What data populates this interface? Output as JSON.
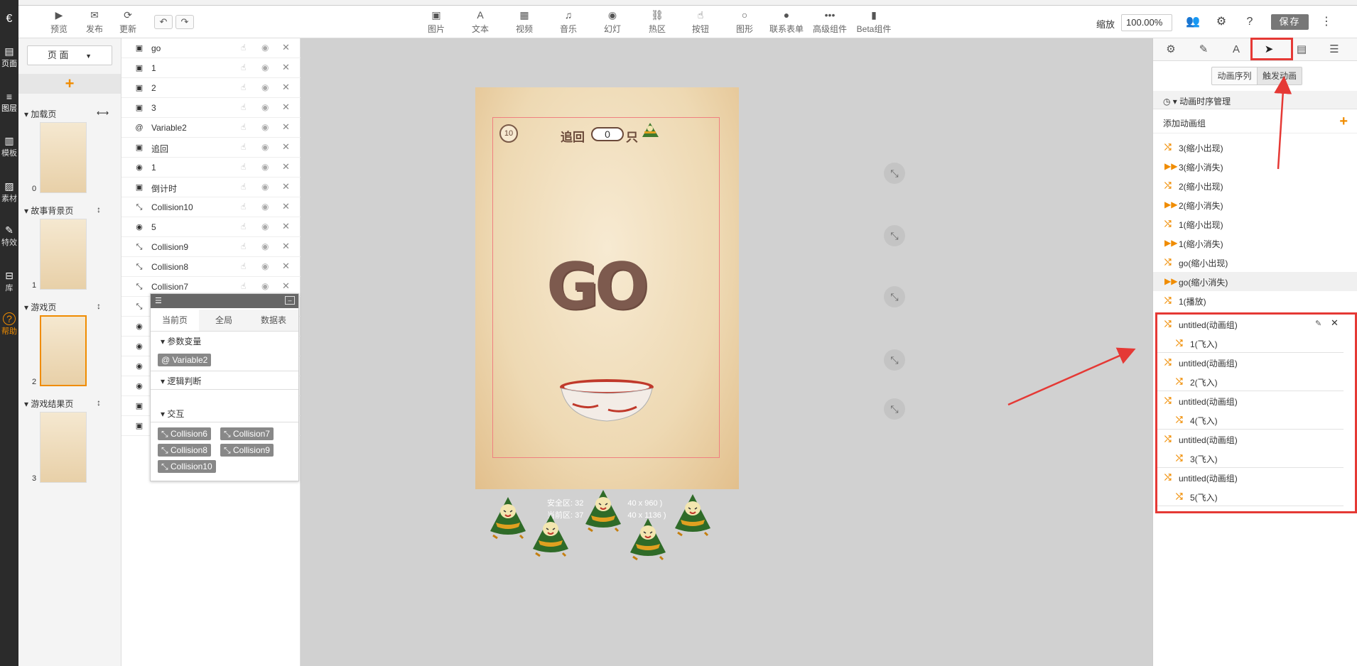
{
  "app_logo": "€",
  "toolbar": {
    "left": [
      {
        "icon": "play-icon",
        "glyph": "▶",
        "label": "预览"
      },
      {
        "icon": "wechat-icon",
        "glyph": "✉",
        "label": "发布"
      },
      {
        "icon": "refresh-icon",
        "glyph": "⟳",
        "label": "更新"
      }
    ],
    "undo_glyph": "↶",
    "redo_glyph": "↷",
    "components": [
      {
        "icon": "image-icon",
        "glyph": "▣",
        "label": "图片"
      },
      {
        "icon": "text-icon",
        "glyph": "A",
        "label": "文本"
      },
      {
        "icon": "video-icon",
        "glyph": "▦",
        "label": "视频"
      },
      {
        "icon": "music-icon",
        "glyph": "♫",
        "label": "音乐"
      },
      {
        "icon": "slideshow-icon",
        "glyph": "◉",
        "label": "幻灯"
      },
      {
        "icon": "hotspot-icon",
        "glyph": "⛓",
        "label": "热区"
      },
      {
        "icon": "button-icon",
        "glyph": "☝",
        "label": "按钮"
      },
      {
        "icon": "shape-icon",
        "glyph": "○",
        "label": "图形"
      },
      {
        "icon": "contact-form-icon",
        "glyph": "●",
        "label": "联系表单"
      },
      {
        "icon": "advanced-icon",
        "glyph": "•••",
        "label": "高级组件"
      },
      {
        "icon": "beta-icon",
        "glyph": "▮",
        "label": "Beta组件"
      }
    ],
    "zoom_label": "缩放",
    "zoom_value": "100.00%",
    "save_label": "保存"
  },
  "rail": [
    {
      "icon": "page-icon",
      "glyph": "▤",
      "label": "页面"
    },
    {
      "icon": "layers-icon",
      "glyph": "≡",
      "label": "图层"
    },
    {
      "icon": "template-icon",
      "glyph": "▥",
      "label": "模板"
    },
    {
      "icon": "material-icon",
      "glyph": "▨",
      "label": "素材"
    },
    {
      "icon": "effect-icon",
      "glyph": "✎",
      "label": "特效"
    },
    {
      "icon": "library-icon",
      "glyph": "⊟",
      "label": "库"
    },
    {
      "icon": "help-icon",
      "glyph": "?",
      "label": "帮助"
    }
  ],
  "pages": {
    "select_label": "页 面",
    "add": "+",
    "items": [
      {
        "title": "加载页",
        "num": "0",
        "action": "⟷"
      },
      {
        "title": "故事背景页",
        "num": "1",
        "action": "↕"
      },
      {
        "title": "游戏页",
        "num": "2",
        "action": "↕"
      },
      {
        "title": "游戏结果页",
        "num": "3",
        "action": "↕"
      }
    ]
  },
  "layers": [
    {
      "icon": "▣",
      "name": "go"
    },
    {
      "icon": "▣",
      "name": "1"
    },
    {
      "icon": "▣",
      "name": "2"
    },
    {
      "icon": "▣",
      "name": "3"
    },
    {
      "icon": "@",
      "name": "Variable2"
    },
    {
      "icon": "▣",
      "name": "追回"
    },
    {
      "icon": "◉",
      "name": "1"
    },
    {
      "icon": "▣",
      "name": "倒计时"
    },
    {
      "icon": "⤡",
      "name": "Collision10"
    },
    {
      "icon": "◉",
      "name": "5"
    },
    {
      "icon": "⤡",
      "name": "Collision9"
    },
    {
      "icon": "⤡",
      "name": "Collision8"
    },
    {
      "icon": "⤡",
      "name": "Collision7"
    },
    {
      "icon": "⤡",
      "name": ""
    },
    {
      "icon": "◉",
      "name": ""
    },
    {
      "icon": "◉",
      "name": ""
    },
    {
      "icon": "◉",
      "name": ""
    },
    {
      "icon": "◉",
      "name": ""
    },
    {
      "icon": "▣",
      "name": ""
    },
    {
      "icon": "▣",
      "name": ""
    }
  ],
  "var_panel": {
    "tabs": [
      "当前页",
      "全局",
      "数据表"
    ],
    "sections": {
      "params": "参数变量",
      "logic": "逻辑判断",
      "interact": "交互"
    },
    "params": [
      "Variable2"
    ],
    "interactions": [
      "Collision6",
      "Collision7",
      "Collision8",
      "Collision9",
      "Collision10"
    ]
  },
  "canvas": {
    "timer": "10",
    "chase_label": "追回",
    "chase_count": "0",
    "chase_unit": "只",
    "go_text": "GO",
    "safe_line1": "安全区: 32",
    "safe_line1b": "40 x 960 )",
    "safe_line2": "当前区: 37",
    "safe_line2b": "40 x 1136 )"
  },
  "right_panel": {
    "tabs": [
      {
        "icon": "gear-icon",
        "glyph": "⚙"
      },
      {
        "icon": "pen-icon",
        "glyph": "✎"
      },
      {
        "icon": "font-icon",
        "glyph": "A"
      },
      {
        "icon": "send-icon",
        "glyph": "➤"
      },
      {
        "icon": "doc-icon",
        "glyph": "▤"
      },
      {
        "icon": "database-icon",
        "glyph": "☰"
      }
    ],
    "seg_sequence": "动画序列",
    "seg_trigger": "触发动画",
    "manager_title": "动画时序管理",
    "add_group": "添加动画组",
    "animations": [
      {
        "glyph": "⤭",
        "text": "3(缩小出现)"
      },
      {
        "glyph": "▶▶",
        "text": "3(缩小消失)"
      },
      {
        "glyph": "⤭",
        "text": "2(缩小出现)"
      },
      {
        "glyph": "▶▶",
        "text": "2(缩小消失)"
      },
      {
        "glyph": "⤭",
        "text": "1(缩小出现)"
      },
      {
        "glyph": "▶▶",
        "text": "1(缩小消失)"
      },
      {
        "glyph": "⤭",
        "text": "go(缩小出现)"
      },
      {
        "glyph": "▶▶",
        "text": "go(缩小消失)"
      },
      {
        "glyph": "⤭",
        "text": "1(播放)"
      }
    ],
    "groups": [
      {
        "title": "untitled(动画组)",
        "sub": "1(飞入)"
      },
      {
        "title": "untitled(动画组)",
        "sub": "2(飞入)"
      },
      {
        "title": "untitled(动画组)",
        "sub": "4(飞入)"
      },
      {
        "title": "untitled(动画组)",
        "sub": "3(飞入)"
      },
      {
        "title": "untitled(动画组)",
        "sub": "5(飞入)"
      }
    ]
  },
  "colors": {
    "accent": "#f08c00",
    "highlight": "#e53935",
    "dark_rail": "#2b2b2b"
  }
}
